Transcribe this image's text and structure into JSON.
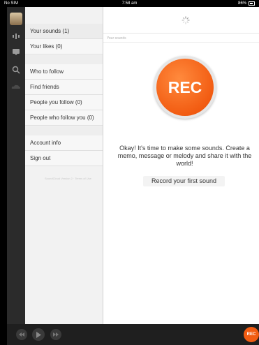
{
  "status_bar": {
    "carrier": "No SIM",
    "time": "7:58 am",
    "battery": "86%"
  },
  "menu": {
    "items": [
      {
        "label": "Your sounds (1)",
        "active": true
      },
      {
        "label": "Your likes (0)",
        "active": false
      },
      {
        "label": "Who to follow",
        "active": false
      },
      {
        "label": "Find friends",
        "active": false
      },
      {
        "label": "People you follow (0)",
        "active": false
      },
      {
        "label": "People who follow you (0)",
        "active": false
      },
      {
        "label": "Account info",
        "active": false
      },
      {
        "label": "Sign out",
        "active": false
      }
    ],
    "footer": "SoundCloud Version 2 · Terms of Use"
  },
  "main": {
    "subheader": "Your sounds",
    "rec_label": "REC",
    "empty_message": "Okay! It's time to make some sounds. Create a memo, message or melody and share it with the world!",
    "record_link": "Record your first sound"
  },
  "bottom_bar": {
    "rec_label": "REC"
  },
  "colors": {
    "accent": "#f25c12",
    "rail": "#2b2b2b",
    "bottom_bar": "#1f1f1f"
  }
}
